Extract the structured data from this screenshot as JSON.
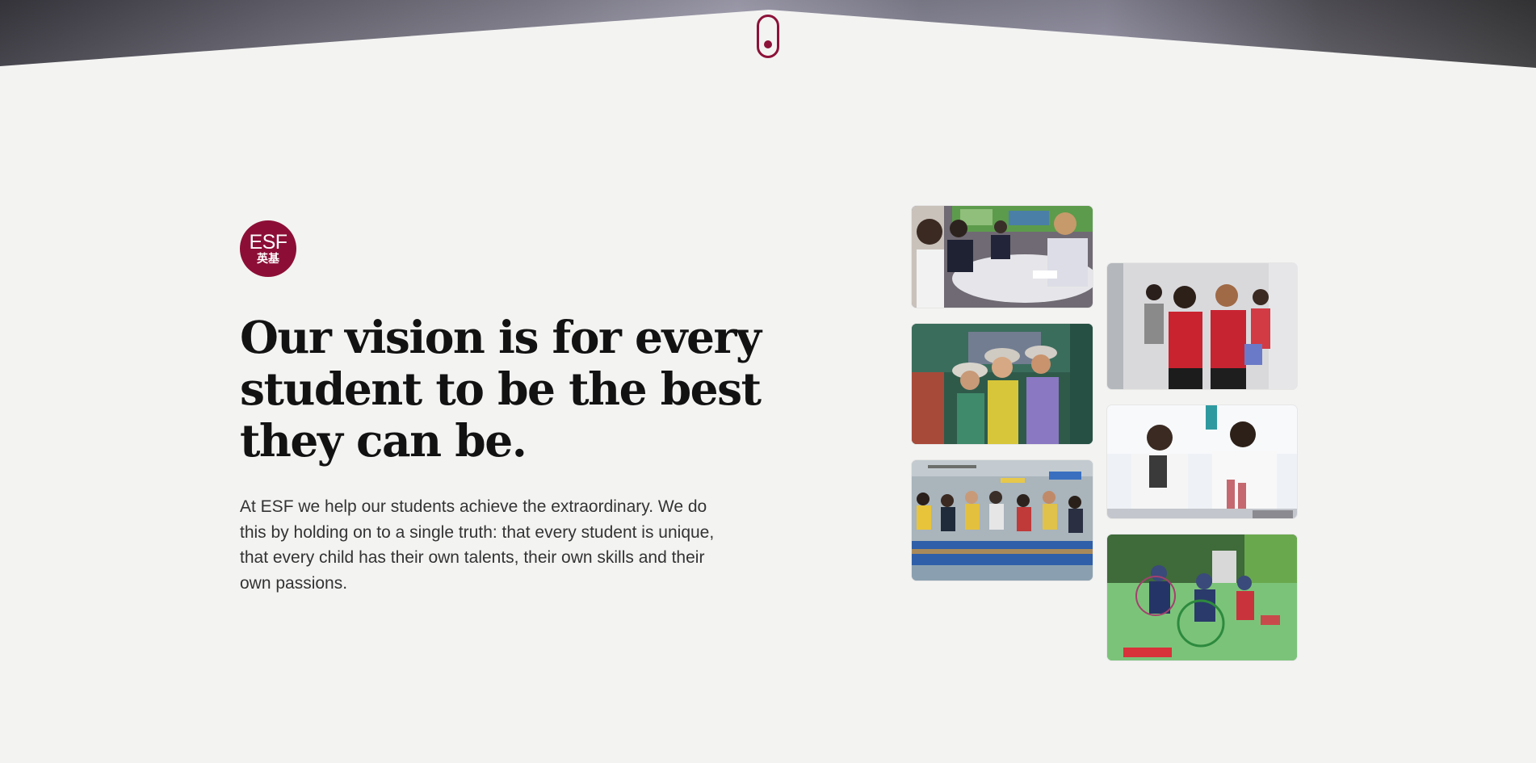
{
  "scroll_indicator": {
    "icon": "mouse-scroll-icon",
    "color": "#8c1239"
  },
  "logo": {
    "text_en": "ESF",
    "text_zh": "英基",
    "color": "#8c0e36"
  },
  "headline": {
    "line1": "Our vision is for every",
    "line2": "student to be the best",
    "line3": "they can be."
  },
  "body": {
    "text": "At ESF we help our students achieve the extraordinary. We do this by holding on to a single truth: that every student is unique, that every child has their own talents, their own skills and their own passions."
  },
  "gallery": {
    "photos": [
      {
        "subject": "students-discussing-at-table"
      },
      {
        "subject": "children-in-sun-hats-at-playground"
      },
      {
        "subject": "students-rafting-outdoors"
      },
      {
        "subject": "students-walking-in-red-uniforms"
      },
      {
        "subject": "students-doing-science-experiment"
      },
      {
        "subject": "children-playing-with-hoops"
      }
    ]
  }
}
